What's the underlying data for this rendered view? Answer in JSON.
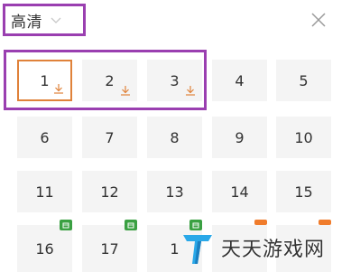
{
  "header": {
    "quality_label": "高清",
    "quality_chevron_icon": "chevron-down-icon",
    "close_icon": "close-icon"
  },
  "episodes": [
    {
      "label": "1",
      "selected": true,
      "downloaded": true
    },
    {
      "label": "2",
      "downloaded": true
    },
    {
      "label": "3",
      "downloaded": true
    },
    {
      "label": "4"
    },
    {
      "label": "5"
    },
    {
      "label": "6"
    },
    {
      "label": "7"
    },
    {
      "label": "8"
    },
    {
      "label": "9"
    },
    {
      "label": "10"
    },
    {
      "label": "11"
    },
    {
      "label": "12"
    },
    {
      "label": "13"
    },
    {
      "label": "14"
    },
    {
      "label": "15"
    },
    {
      "label": "16",
      "badge": "green"
    },
    {
      "label": "17",
      "badge": "green"
    },
    {
      "label": "1",
      "badge": "green"
    },
    {
      "label": "",
      "badge": "orange"
    },
    {
      "label": "",
      "badge": "orange"
    }
  ],
  "colors": {
    "selected_border": "#e0823a",
    "download_icon": "#e0823a",
    "annotation_box": "#9a3fb0",
    "tile_bg": "#f4f4f4",
    "badge_green": "#3aa042",
    "badge_orange": "#f07c2c",
    "watermark_logo": "#2aa8e8"
  },
  "watermark": {
    "text": "天天游戏网",
    "logo_icon": "t-logo-icon"
  }
}
